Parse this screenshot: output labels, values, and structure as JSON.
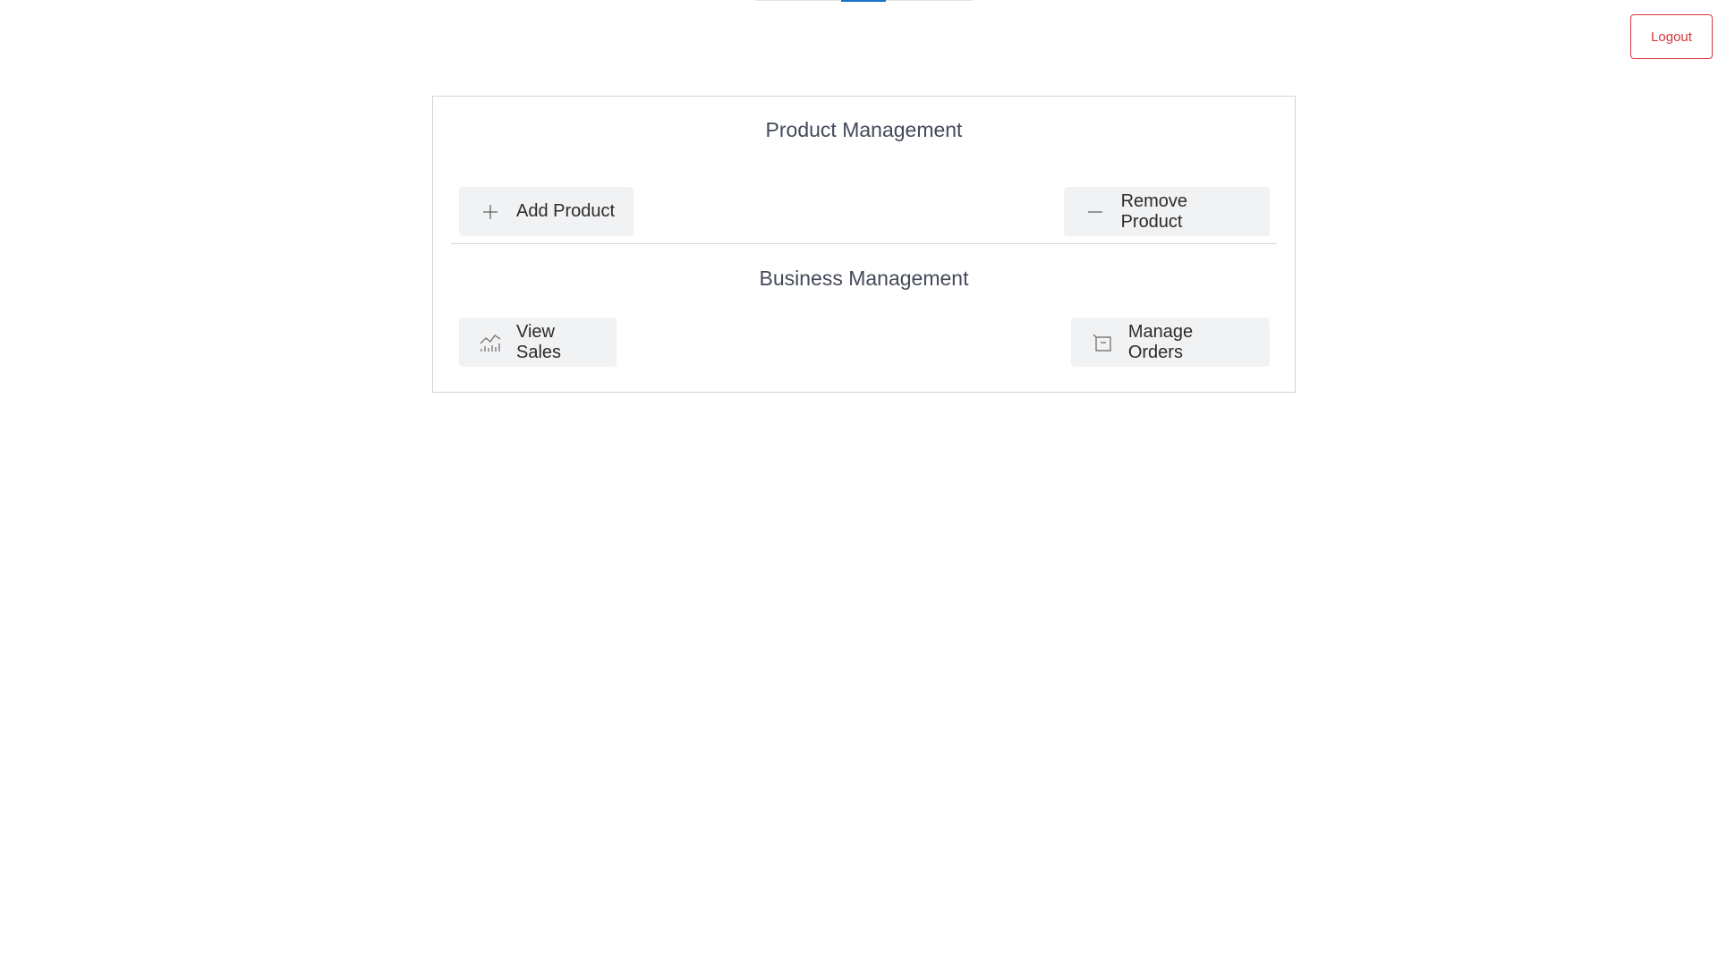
{
  "header": {
    "logout_label": "Logout"
  },
  "product_management": {
    "title": "Product Management",
    "add_label": "Add Product",
    "remove_label": "Remove Product"
  },
  "business_management": {
    "title": "Business Management",
    "sales_label": "View Sales",
    "orders_label": "Manage Orders"
  },
  "icons": {
    "add": "plus-icon",
    "remove": "minus-icon",
    "sales": "chart-icon",
    "orders": "box-icon"
  },
  "colors": {
    "logout": "#d9363e",
    "accent": "#1a73c9",
    "button_bg": "#f1f2f4",
    "title_text": "#444a5a"
  }
}
